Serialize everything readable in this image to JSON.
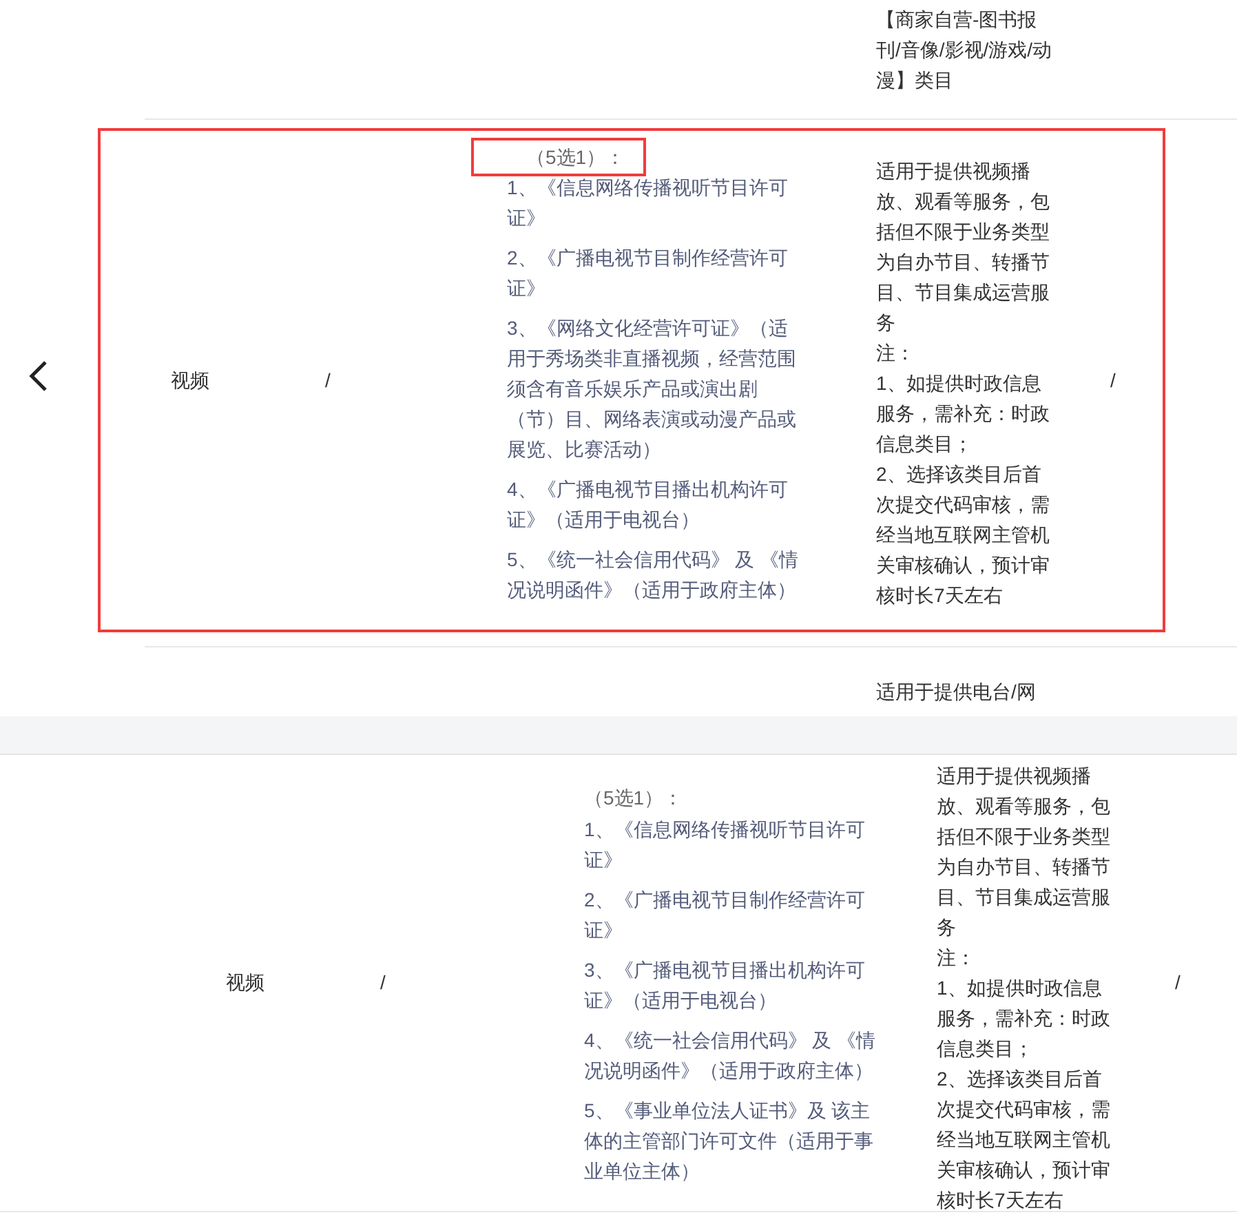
{
  "upper_panel": {
    "top_row": {
      "description": "【商家自营-图书报刊/音像/影视/游戏/动漫】类目"
    },
    "row": {
      "highlighted": true,
      "category": "视频",
      "column_2": "/",
      "option_count": "（5选1）：",
      "option_count_highlighted": true,
      "licenses": [
        "1、《信息网络传播视听节目许可证》",
        "2、《广播电视节目制作经营许可证》",
        "3、《网络文化经营许可证》（适用于秀场类非直播视频，经营范围须含有音乐娱乐产品或演出剧（节）目、网络表演或动漫产品或展览、比赛活动）",
        "4、《广播电视节目播出机构许可证》（适用于电视台）",
        "5、《统一社会信用代码》 及 《情况说明函件》（适用于政府主体）"
      ],
      "description": [
        "适用于提供视频播放、观看等服务，包括但不限于业务类型为自办节目、转播节目、节目集成运营服务",
        "注：",
        "1、如提供时政信息服务，需补充：时政信息类目；",
        "2、选择该类目后首次提交代码审核，需经当地互联网主管机关审核确认，预计审核时长7天左右"
      ],
      "column_5": "/"
    },
    "bottom_row": {
      "description": "适用于提供电台/网"
    }
  },
  "lower_panel": {
    "row": {
      "category": "视频",
      "column_2": "/",
      "option_count": "（5选1）：",
      "licenses": [
        "1、《信息网络传播视听节目许可证》",
        "2、《广播电视节目制作经营许可证》",
        "3、《广播电视节目播出机构许可证》（适用于电视台）",
        "4、《统一社会信用代码》 及 《情况说明函件》（适用于政府主体）",
        "5、《事业单位法人证书》及 该主体的主管部门许可文件（适用于事业单位主体）"
      ],
      "description": [
        "适用于提供视频播放、观看等服务，包括但不限于业务类型为自办节目、转播节目、节目集成运营服务",
        "注：",
        "1、如提供时政信息服务，需补充：时政信息类目；",
        "2、选择该类目后首次提交代码审核，需经当地互联网主管机关审核确认，预计审核时长7天左右"
      ],
      "column_5": "/"
    }
  }
}
